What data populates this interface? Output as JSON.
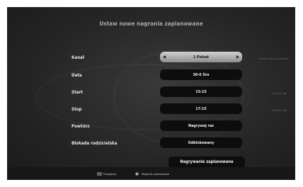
{
  "screen": {
    "title": "Ustaw nowe nagrania zaplanowane"
  },
  "form": {
    "rows": [
      {
        "label": "Kanał",
        "value": "1 Polsat",
        "hint": "naciśnij ◄ ► lub przewijaj"
      },
      {
        "label": "Data",
        "value": "30-6 Śro",
        "hint": ""
      },
      {
        "label": "Start",
        "value": "15:15",
        "hint": "naciśnij ◄ ►"
      },
      {
        "label": "Stop",
        "value": "17:15",
        "hint": "naciśnij ◄ ►"
      },
      {
        "label": "Powtórz",
        "value": "Nagrywaj raz",
        "hint": ""
      },
      {
        "label": "Blokada rodzicielska",
        "value": "Odblokowany",
        "hint": ""
      }
    ],
    "submit_label": "Nagrywanie zaplanowane"
  },
  "footer": {
    "items": [
      {
        "label": "Przeglądaj",
        "icon": "navigate-icon"
      },
      {
        "label": "Nagrania zaplanowane",
        "icon": "record-icon"
      }
    ]
  },
  "colors": {
    "background": "#262626",
    "field": "#0d0d0d",
    "selected_field": "#b0b0b0",
    "label_text": "#e8e8e8",
    "title_text": "#a9a9a9"
  }
}
